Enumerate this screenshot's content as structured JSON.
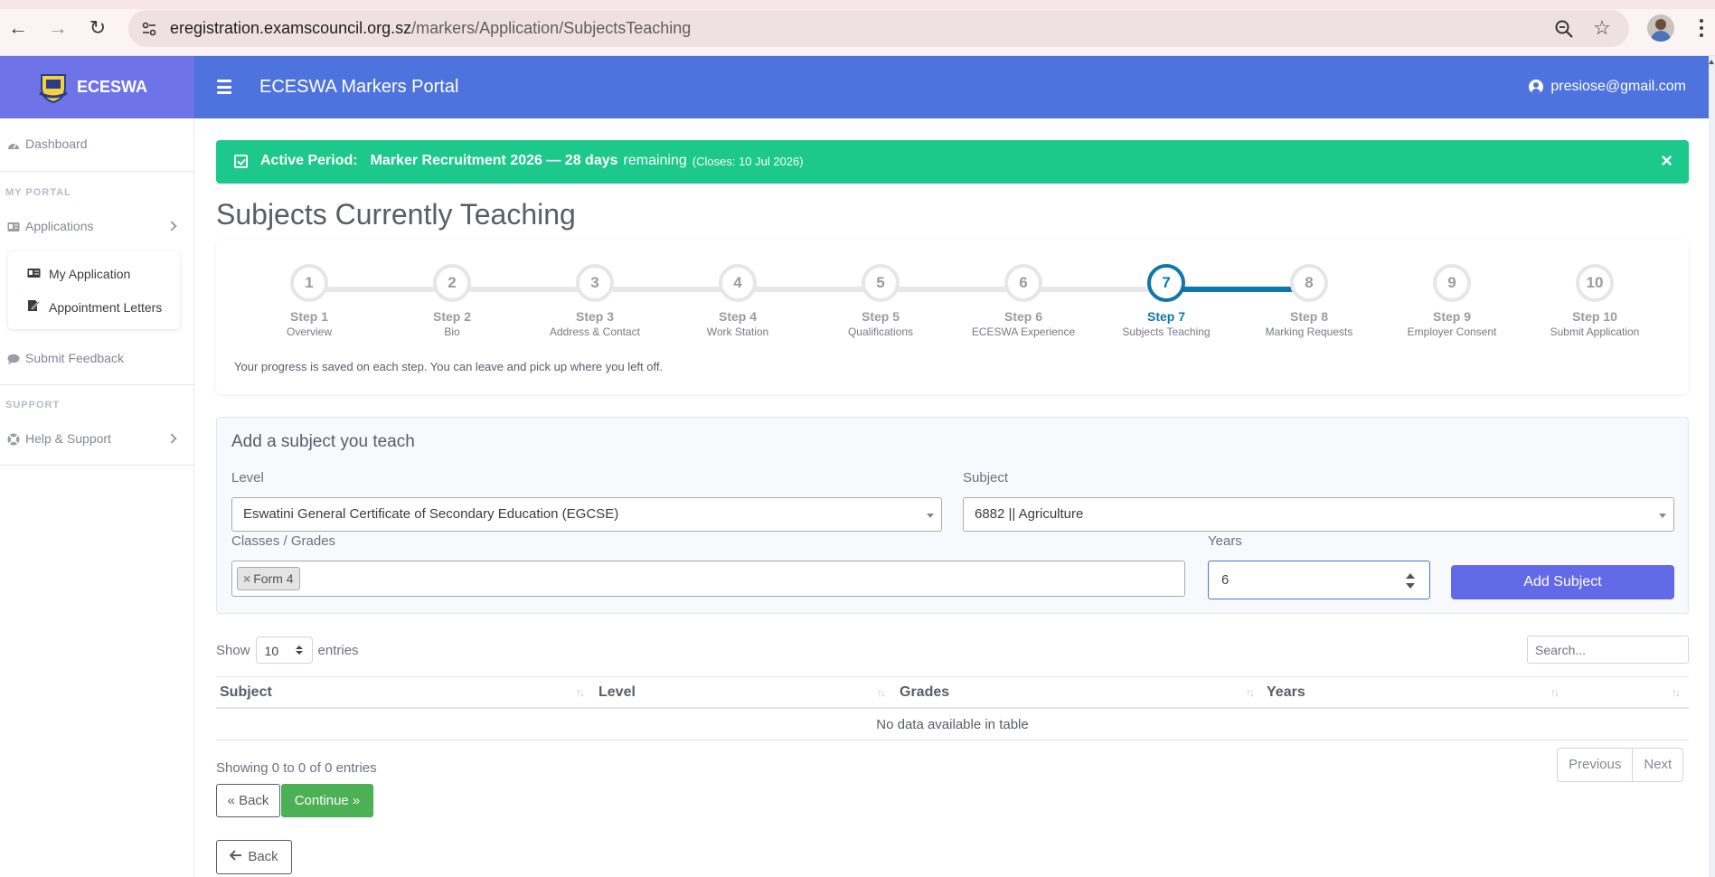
{
  "browser": {
    "url_domain": "eregistration.examscouncil.org.sz",
    "url_path": "/markers/Application/SubjectsTeaching"
  },
  "topbar": {
    "brand": "ECESWA",
    "portal_title": "ECESWA Markers Portal",
    "user_email": "presiose@gmail.com"
  },
  "sidebar": {
    "dashboard": "Dashboard",
    "my_portal_heading": "MY PORTAL",
    "applications": "Applications",
    "submenu": {
      "my_application": "My Application",
      "appointment_letters": "Appointment Letters"
    },
    "submit_feedback": "Submit Feedback",
    "support_heading": "SUPPORT",
    "help_support": "Help & Support"
  },
  "alert": {
    "label": "Active Period:",
    "period": "Marker Recruitment 2026 — 28 days",
    "remaining": "remaining",
    "closes": "(Closes: 10 Jul 2026)",
    "close_symbol": "×"
  },
  "page_title": "Subjects Currently Teaching",
  "steps": [
    {
      "num": "1",
      "title": "Step 1",
      "sub": "Overview"
    },
    {
      "num": "2",
      "title": "Step 2",
      "sub": "Bio"
    },
    {
      "num": "3",
      "title": "Step 3",
      "sub": "Address & Contact"
    },
    {
      "num": "4",
      "title": "Step 4",
      "sub": "Work Station"
    },
    {
      "num": "5",
      "title": "Step 5",
      "sub": "Qualifications"
    },
    {
      "num": "6",
      "title": "Step 6",
      "sub": "ECESWA Experience"
    },
    {
      "num": "7",
      "title": "Step 7",
      "sub": "Subjects Teaching"
    },
    {
      "num": "8",
      "title": "Step 8",
      "sub": "Marking Requests"
    },
    {
      "num": "9",
      "title": "Step 9",
      "sub": "Employer Consent"
    },
    {
      "num": "10",
      "title": "Step 10",
      "sub": "Submit Application"
    }
  ],
  "step_note": "Your progress is saved on each step. You can leave and pick up where you left off.",
  "form": {
    "heading": "Add a subject you teach",
    "level_label": "Level",
    "level_value": "Eswatini General Certificate of Secondary Education (EGCSE)",
    "subject_label": "Subject",
    "subject_value": "6882 || Agriculture",
    "grades_label": "Classes / Grades",
    "grade_tag": "Form 4",
    "tag_remove": "×",
    "years_label": "Years",
    "years_value": "6",
    "add_button": "Add Subject"
  },
  "table": {
    "show": "Show",
    "length": "10",
    "entries": "entries",
    "search_placeholder": "Search...",
    "columns": [
      "Subject",
      "Level",
      "Grades",
      "Years"
    ],
    "empty": "No data available in table",
    "info": "Showing 0 to 0 of 0 entries",
    "previous": "Previous",
    "next": "Next"
  },
  "buttons": {
    "back_small": "« Back",
    "continue": "Continue »",
    "back": "Back"
  }
}
